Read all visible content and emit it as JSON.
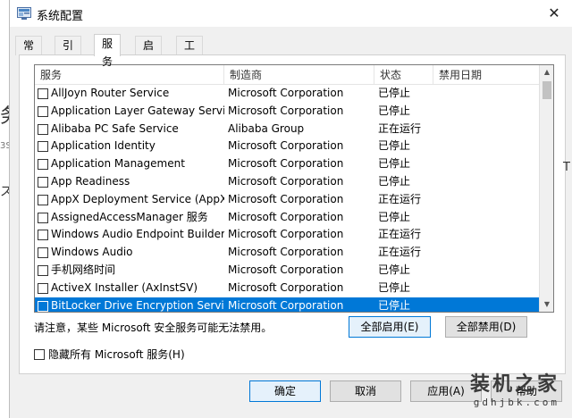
{
  "window": {
    "title": "系统配置",
    "close_glyph": "✕"
  },
  "background": {
    "left_glyph_1": "务",
    "left_glyph_2": "ス",
    "left_glyph_3": "3S",
    "right_glyph": "T"
  },
  "tabs": [
    {
      "label": "常规",
      "active": false
    },
    {
      "label": "引导",
      "active": false
    },
    {
      "label": "服务",
      "active": true
    },
    {
      "label": "启动",
      "active": false
    },
    {
      "label": "工具",
      "active": false
    }
  ],
  "services": {
    "columns": {
      "name": "服务",
      "maker": "制造商",
      "status": "状态",
      "date": "禁用日期"
    },
    "rows": [
      {
        "name": "AllJoyn Router Service",
        "maker": "Microsoft Corporation",
        "status": "已停止",
        "date": "",
        "selected": false
      },
      {
        "name": "Application Layer Gateway Service",
        "maker": "Microsoft Corporation",
        "status": "已停止",
        "date": "",
        "selected": false
      },
      {
        "name": "Alibaba PC Safe Service",
        "maker": "Alibaba Group",
        "status": "正在运行",
        "date": "",
        "selected": false
      },
      {
        "name": "Application Identity",
        "maker": "Microsoft Corporation",
        "status": "已停止",
        "date": "",
        "selected": false
      },
      {
        "name": "Application Management",
        "maker": "Microsoft Corporation",
        "status": "已停止",
        "date": "",
        "selected": false
      },
      {
        "name": "App Readiness",
        "maker": "Microsoft Corporation",
        "status": "已停止",
        "date": "",
        "selected": false
      },
      {
        "name": "AppX Deployment Service (AppX...",
        "maker": "Microsoft Corporation",
        "status": "正在运行",
        "date": "",
        "selected": false
      },
      {
        "name": "AssignedAccessManager 服务",
        "maker": "Microsoft Corporation",
        "status": "已停止",
        "date": "",
        "selected": false
      },
      {
        "name": "Windows Audio Endpoint Builder",
        "maker": "Microsoft Corporation",
        "status": "正在运行",
        "date": "",
        "selected": false
      },
      {
        "name": "Windows Audio",
        "maker": "Microsoft Corporation",
        "status": "正在运行",
        "date": "",
        "selected": false
      },
      {
        "name": "手机网络时间",
        "maker": "Microsoft Corporation",
        "status": "已停止",
        "date": "",
        "selected": false
      },
      {
        "name": "ActiveX Installer (AxInstSV)",
        "maker": "Microsoft Corporation",
        "status": "已停止",
        "date": "",
        "selected": false
      },
      {
        "name": "BitLocker Drive Encryption Service",
        "maker": "Microsoft Corporation",
        "status": "已停止",
        "date": "",
        "selected": true
      }
    ],
    "scroll_up_glyph": "▲",
    "scroll_down_glyph": "▼"
  },
  "note": "请注意，某些 Microsoft 安全服务可能无法禁用。",
  "buttons": {
    "enable_all": "全部启用(E)",
    "disable_all": "全部禁用(D)",
    "ok": "确定",
    "cancel": "取消",
    "apply": "应用(A)",
    "help": "帮助"
  },
  "hide_ms_services": {
    "label": "隐藏所有 Microsoft 服务(H)",
    "checked": false
  },
  "watermark": {
    "main": "装机之家",
    "sub": "gdhjbk.com"
  },
  "colors": {
    "selection": "#0078d7",
    "focus_border": "#0078d7",
    "window_bg": "#f0f0f0"
  }
}
